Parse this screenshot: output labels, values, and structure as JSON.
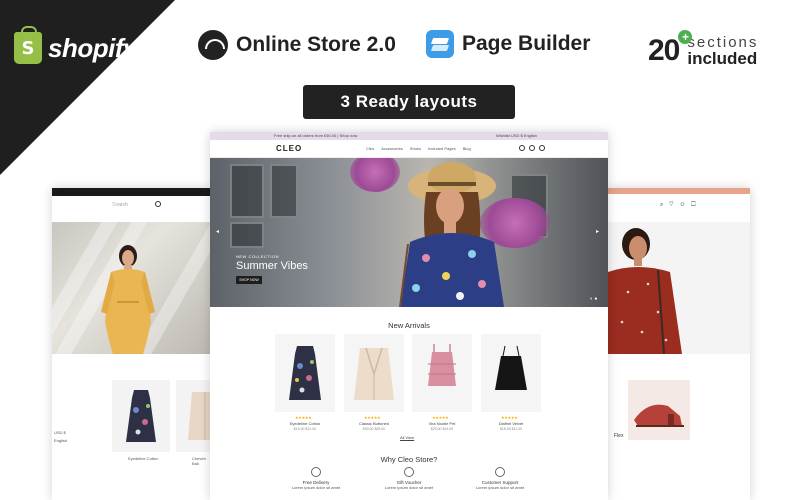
{
  "banner": {
    "platform": "shopify",
    "feature_1": "Online Store 2.0",
    "feature_2": "Page Builder",
    "sections_number": "20",
    "sections_plus": "+",
    "sections_line1": "sections",
    "sections_line2": "included",
    "layouts_pill": "3 Ready layouts"
  },
  "left_mockup": {
    "search": "Search",
    "products": [
      "Eyedeline Cotton",
      "Cheveh Bak"
    ],
    "side_labels": [
      "USD $",
      "English"
    ]
  },
  "center_mockup": {
    "announcement": "Free ship on all orders from £50.00 | Shop now",
    "currency": "Wishlist    USD $    English",
    "logo": "CLEO",
    "menu": [
      "Cleo",
      "Accessories",
      "Shoes",
      "Included Pages",
      "Blog"
    ],
    "hero": {
      "tag": "NEW COLLECTION",
      "title": "Summer Vibes",
      "button": "SHOP NOW"
    },
    "new_arrivals_title": "New Arrivals",
    "products": [
      {
        "name": "Eyedeline Cotton",
        "price": "$15.00  $12.00"
      },
      {
        "name": "Classic Buttoned",
        "price": "$30.00  $25.00"
      },
      {
        "name": "Vira Nootie Pet",
        "price": "$20.00  $14.00"
      },
      {
        "name": "Diafhel Velvet",
        "price": "$18.00  $11.00"
      }
    ],
    "all_view": "All View",
    "why_title": "Why Cleo Store?",
    "features": [
      {
        "title": "Free Delivery",
        "text": "Lorem ipsum dolor sit amet"
      },
      {
        "title": "Gift Voucher",
        "text": "Lorem ipsum dolor sit amet"
      },
      {
        "title": "Customer Support",
        "text": "Lorem ipsum dolor sit amet"
      }
    ]
  },
  "right_mockup": {
    "icons": "⌕ ♡ ☺ ☐",
    "product_name": "Flex"
  },
  "colors": {
    "dark": "#1f1f1f",
    "shopify_green": "#95bf47",
    "accent_blue": "#3d9ce8",
    "plus_green": "#4caf50",
    "top_bar_purple": "#e5daea",
    "top_bar_salmon": "#e7a38b"
  }
}
